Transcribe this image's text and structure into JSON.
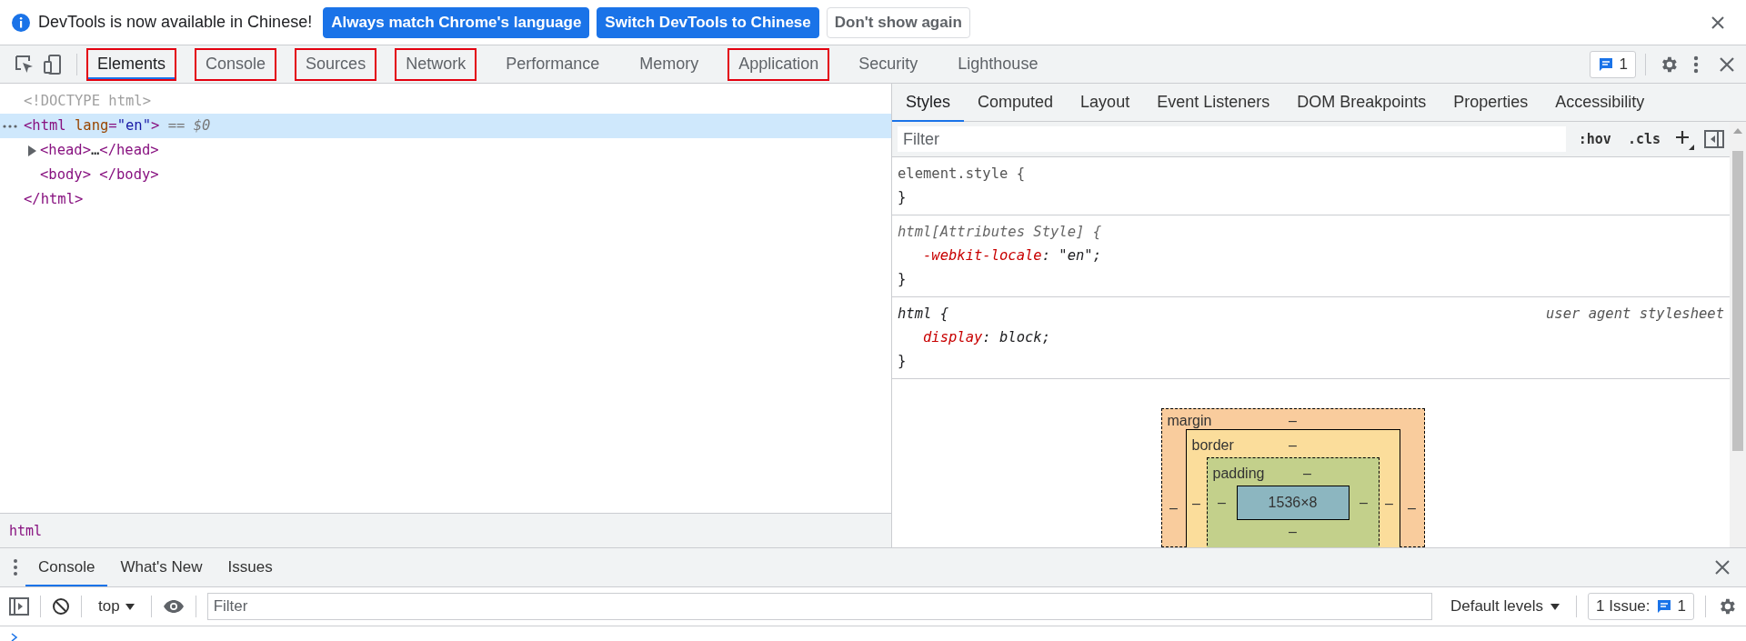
{
  "infobar": {
    "message": "DevTools is now available in Chinese!",
    "buttons": [
      {
        "label": "Always match Chrome's language",
        "kind": "primary"
      },
      {
        "label": "Switch DevTools to Chinese",
        "kind": "primary"
      },
      {
        "label": "Don't show again",
        "kind": "secondary"
      }
    ]
  },
  "main_tabs": [
    {
      "label": "Elements",
      "selected": true,
      "outlined": true
    },
    {
      "label": "Console",
      "selected": false,
      "outlined": true
    },
    {
      "label": "Sources",
      "selected": false,
      "outlined": true
    },
    {
      "label": "Network",
      "selected": false,
      "outlined": true
    },
    {
      "label": "Performance",
      "selected": false,
      "outlined": false
    },
    {
      "label": "Memory",
      "selected": false,
      "outlined": false
    },
    {
      "label": "Application",
      "selected": false,
      "outlined": true
    },
    {
      "label": "Security",
      "selected": false,
      "outlined": false
    },
    {
      "label": "Lighthouse",
      "selected": false,
      "outlined": false
    }
  ],
  "issues_count": "1",
  "dom_tree": [
    {
      "selected": false,
      "parts": [
        {
          "kind": "doctype",
          "text": "<!DOCTYPE html>"
        }
      ]
    },
    {
      "selected": true,
      "parts": [
        {
          "kind": "tag",
          "text": "<html "
        },
        {
          "kind": "attr",
          "text": "lang"
        },
        {
          "kind": "tag",
          "text": "="
        },
        {
          "kind": "value",
          "text": "\"en\""
        },
        {
          "kind": "tag",
          "text": ">"
        },
        {
          "kind": "marker",
          "text": " == $0"
        }
      ],
      "children": [
        {
          "selected": false,
          "expanded": false,
          "parts": [
            {
              "kind": "tag",
              "text": "<head>"
            },
            {
              "kind": "ellipsis",
              "text": "…"
            },
            {
              "kind": "tag",
              "text": "</head>"
            }
          ]
        },
        {
          "selected": false,
          "parts": [
            {
              "kind": "tag",
              "text": "<body>"
            },
            {
              "kind": "tag",
              "text": " </body>"
            }
          ]
        }
      ],
      "closing": [
        {
          "kind": "tag",
          "text": "</html>"
        }
      ]
    }
  ],
  "breadcrumb": "html",
  "styles_tabs": [
    {
      "label": "Styles",
      "selected": true
    },
    {
      "label": "Computed",
      "selected": false
    },
    {
      "label": "Layout",
      "selected": false
    },
    {
      "label": "Event Listeners",
      "selected": false
    },
    {
      "label": "DOM Breakpoints",
      "selected": false
    },
    {
      "label": "Properties",
      "selected": false
    },
    {
      "label": "Accessibility",
      "selected": false
    }
  ],
  "styles_filter": {
    "placeholder": "Filter"
  },
  "styles_buttons": [
    ":hov",
    ".cls"
  ],
  "rules": [
    {
      "kind": "inline",
      "selector": "element.style {",
      "closing": "}"
    },
    {
      "kind": "attributes",
      "selector": "html[Attributes Style] {",
      "declarations": [
        {
          "property": "-webkit-locale",
          "value": ": \"en\";"
        }
      ],
      "closing": "}"
    },
    {
      "kind": "user-agent",
      "selector": "html {",
      "origin": "user agent stylesheet",
      "declarations": [
        {
          "property": "display",
          "value": ": block;"
        }
      ],
      "closing": "}"
    }
  ],
  "box_model": {
    "margin": {
      "label": "margin",
      "top": "–",
      "left": "–",
      "right": "–"
    },
    "border": {
      "label": "border",
      "top": "–",
      "left": "–",
      "right": "–"
    },
    "padding": {
      "label": "padding",
      "top": "–",
      "left": "–",
      "right": "–",
      "bottom": "–"
    },
    "content": "1536×8"
  },
  "drawer_tabs": [
    {
      "label": "Console",
      "selected": true
    },
    {
      "label": "What's New",
      "selected": false
    },
    {
      "label": "Issues",
      "selected": false
    }
  ],
  "console_toolbar": {
    "context": "top",
    "filter": {
      "placeholder": "Filter"
    },
    "levels": "Default levels",
    "issues_label": "1 Issue:",
    "issues_count": "1"
  }
}
